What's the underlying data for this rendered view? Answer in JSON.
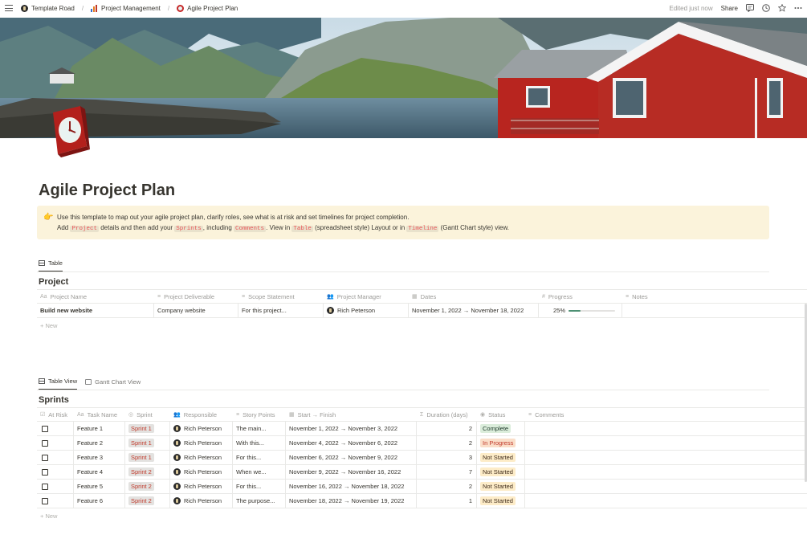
{
  "topbar": {
    "breadcrumbs": [
      {
        "label": "Template Road",
        "icon": "road-logo-icon"
      },
      {
        "label": "Project Management",
        "icon": "bar-chart-icon"
      },
      {
        "label": "Agile Project Plan",
        "icon": "alarm-clock-icon"
      }
    ],
    "edited": "Edited just now",
    "share": "Share"
  },
  "page": {
    "title": "Agile Project Plan",
    "callout": {
      "line1": "Use this template to map out your agile project plan, clarify roles, see what is at risk and set timelines for project completion.",
      "line2_a": "Add ",
      "code_project": "Project",
      "line2_b": " details and then add your ",
      "code_sprints": "Sprints",
      "line2_c": ", including ",
      "code_comments": "Comments",
      "line2_d": ". View in ",
      "code_table": "Table",
      "line2_e": " (spreadsheet style) Layout or in ",
      "code_timeline": "Timeline",
      "line2_f": " (Gantt Chart style) view."
    }
  },
  "project": {
    "view_tab": "Table",
    "title": "Project",
    "columns": [
      "Project Name",
      "Project Deliverable",
      "Scope Statement",
      "Project Manager",
      "Dates",
      "Progress",
      "Notes"
    ],
    "row": {
      "name": "Build new website",
      "deliverable": "Company website",
      "scope": "For this project...",
      "manager": "Rich Peterson",
      "dates": "November 1, 2022 → November 18, 2022",
      "progress_label": "25%",
      "progress_value": 0.25,
      "notes": ""
    },
    "new_label": "New"
  },
  "sprints": {
    "view_tabs": [
      "Table View",
      "Gantt Chart View"
    ],
    "title": "Sprints",
    "columns": [
      "At Risk",
      "Task Name",
      "Sprint",
      "Responsible",
      "Story Points",
      "Start → Finish",
      "Duration (days)",
      "Status",
      "Comments"
    ],
    "rows": [
      {
        "task": "Feature 1",
        "sprint": "Sprint 1",
        "responsible": "Rich Peterson",
        "story": "The main...",
        "dates": "November 1, 2022 → November 3, 2022",
        "duration": "2",
        "status": "Complete"
      },
      {
        "task": "Feature 2",
        "sprint": "Sprint 1",
        "responsible": "Rich Peterson",
        "story": "With this...",
        "dates": "November 4, 2022 → November 6, 2022",
        "duration": "2",
        "status": "In Progress"
      },
      {
        "task": "Feature 3",
        "sprint": "Sprint 1",
        "responsible": "Rich Peterson",
        "story": "For this...",
        "dates": "November 6, 2022 → November 9, 2022",
        "duration": "3",
        "status": "Not Started"
      },
      {
        "task": "Feature 4",
        "sprint": "Sprint 2",
        "responsible": "Rich Peterson",
        "story": "When we...",
        "dates": "November 9, 2022 → November 16, 2022",
        "duration": "7",
        "status": "Not Started"
      },
      {
        "task": "Feature 5",
        "sprint": "Sprint 2",
        "responsible": "Rich Peterson",
        "story": "For this...",
        "dates": "November 16, 2022 → November 18, 2022",
        "duration": "2",
        "status": "Not Started"
      },
      {
        "task": "Feature 6",
        "sprint": "Sprint 2",
        "responsible": "Rich Peterson",
        "story": "The purpose...",
        "dates": "November 18, 2022 → November 19, 2022",
        "duration": "1",
        "status": "Not Started"
      }
    ],
    "new_label": "New"
  },
  "colors": {
    "callout_bg": "#fbf3db",
    "code_text": "#eb5757",
    "complete_bg": "#dbeddb",
    "in_progress_bg": "#fadec9",
    "not_started_bg": "#fdecc8",
    "progress_fill": "#4d9073"
  }
}
